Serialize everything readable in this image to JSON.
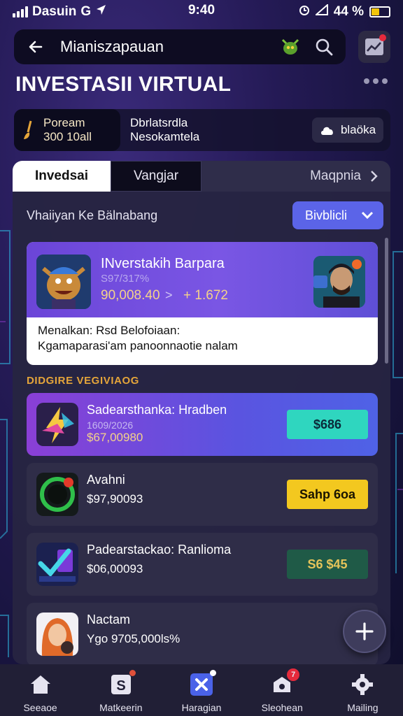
{
  "status_bar": {
    "carrier": "Dasuin",
    "carrier_mark": "G",
    "time": "9:40",
    "battery": "44 %",
    "battery_level": 0.44
  },
  "app_bar": {
    "title": "Mianiszapauan"
  },
  "page": {
    "title": "INVESTASII VIRTUAL"
  },
  "summary": {
    "balance_label": "Poream",
    "balance_value": "300 10all",
    "info_line1": "Dbrlatsrdla",
    "info_line2": "Nesokamtela",
    "chip_label": "blaöka"
  },
  "tabs": [
    {
      "label": "Invedsai"
    },
    {
      "label": "Vangjar"
    },
    {
      "label": "Maqpnia"
    }
  ],
  "filter": {
    "label": "Vhaiiyan Ke Bälnabang",
    "button": "Bivblicli"
  },
  "featured": {
    "title": "INverstakih  Barpara",
    "subtitle": "S97/317%",
    "price": "90,008.40",
    "arrow": ">",
    "change": "+ 1.672",
    "desc_line1": "Menalkan: Rsd Belofoiaan:",
    "desc_line2": "Kgamaparasi'am panoonnaotie nalam"
  },
  "section": {
    "label": "DIDGIRE VEGIVIAOG"
  },
  "assets": [
    {
      "name": "Sadearsthanka: Hradben",
      "meta": "1609/2026",
      "price": "$67,00980",
      "action": "$686",
      "action_bg": "#2fd6bf",
      "action_fg": "#0b2a3a"
    },
    {
      "name": "Avahni",
      "price": "$97,90093",
      "action": "Sahp 6oa",
      "action_bg": "#f3c81f",
      "action_fg": "#1a1400"
    },
    {
      "name": "Padearstackao: Ranlioma",
      "price": "$06,00093",
      "action": "S6 $45",
      "action_bg": "#1f5a47",
      "action_fg": "#e6c45a"
    },
    {
      "name": "Nactam",
      "price": "Ygo 9705,000ls%"
    }
  ],
  "nav": [
    {
      "label": "Seeaoe",
      "icon": "home-icon"
    },
    {
      "label": "Matkeerin",
      "icon": "market-icon"
    },
    {
      "label": "Haragian",
      "icon": "trade-icon"
    },
    {
      "label": "Sleohean",
      "icon": "bag-icon",
      "badge": "7"
    },
    {
      "label": "Mailing",
      "icon": "gear-icon"
    }
  ],
  "colors": {
    "accent": "#5b64e8",
    "gold": "#e5a53a",
    "panel": "#26244a"
  }
}
